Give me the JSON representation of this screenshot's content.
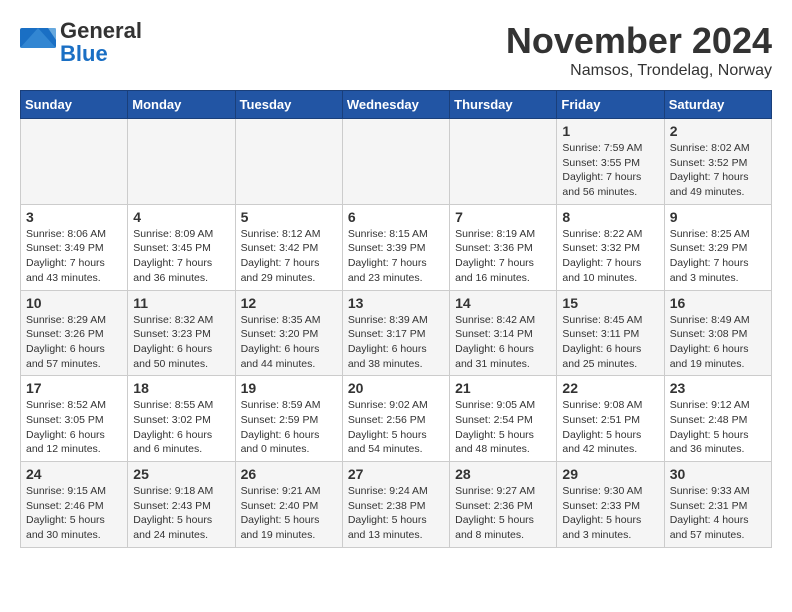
{
  "logo": {
    "general": "General",
    "blue": "Blue"
  },
  "title": "November 2024",
  "location": "Namsos, Trondelag, Norway",
  "days_of_week": [
    "Sunday",
    "Monday",
    "Tuesday",
    "Wednesday",
    "Thursday",
    "Friday",
    "Saturday"
  ],
  "weeks": [
    [
      {
        "day": "",
        "info": ""
      },
      {
        "day": "",
        "info": ""
      },
      {
        "day": "",
        "info": ""
      },
      {
        "day": "",
        "info": ""
      },
      {
        "day": "",
        "info": ""
      },
      {
        "day": "1",
        "info": "Sunrise: 7:59 AM\nSunset: 3:55 PM\nDaylight: 7 hours and 56 minutes."
      },
      {
        "day": "2",
        "info": "Sunrise: 8:02 AM\nSunset: 3:52 PM\nDaylight: 7 hours and 49 minutes."
      }
    ],
    [
      {
        "day": "3",
        "info": "Sunrise: 8:06 AM\nSunset: 3:49 PM\nDaylight: 7 hours and 43 minutes."
      },
      {
        "day": "4",
        "info": "Sunrise: 8:09 AM\nSunset: 3:45 PM\nDaylight: 7 hours and 36 minutes."
      },
      {
        "day": "5",
        "info": "Sunrise: 8:12 AM\nSunset: 3:42 PM\nDaylight: 7 hours and 29 minutes."
      },
      {
        "day": "6",
        "info": "Sunrise: 8:15 AM\nSunset: 3:39 PM\nDaylight: 7 hours and 23 minutes."
      },
      {
        "day": "7",
        "info": "Sunrise: 8:19 AM\nSunset: 3:36 PM\nDaylight: 7 hours and 16 minutes."
      },
      {
        "day": "8",
        "info": "Sunrise: 8:22 AM\nSunset: 3:32 PM\nDaylight: 7 hours and 10 minutes."
      },
      {
        "day": "9",
        "info": "Sunrise: 8:25 AM\nSunset: 3:29 PM\nDaylight: 7 hours and 3 minutes."
      }
    ],
    [
      {
        "day": "10",
        "info": "Sunrise: 8:29 AM\nSunset: 3:26 PM\nDaylight: 6 hours and 57 minutes."
      },
      {
        "day": "11",
        "info": "Sunrise: 8:32 AM\nSunset: 3:23 PM\nDaylight: 6 hours and 50 minutes."
      },
      {
        "day": "12",
        "info": "Sunrise: 8:35 AM\nSunset: 3:20 PM\nDaylight: 6 hours and 44 minutes."
      },
      {
        "day": "13",
        "info": "Sunrise: 8:39 AM\nSunset: 3:17 PM\nDaylight: 6 hours and 38 minutes."
      },
      {
        "day": "14",
        "info": "Sunrise: 8:42 AM\nSunset: 3:14 PM\nDaylight: 6 hours and 31 minutes."
      },
      {
        "day": "15",
        "info": "Sunrise: 8:45 AM\nSunset: 3:11 PM\nDaylight: 6 hours and 25 minutes."
      },
      {
        "day": "16",
        "info": "Sunrise: 8:49 AM\nSunset: 3:08 PM\nDaylight: 6 hours and 19 minutes."
      }
    ],
    [
      {
        "day": "17",
        "info": "Sunrise: 8:52 AM\nSunset: 3:05 PM\nDaylight: 6 hours and 12 minutes."
      },
      {
        "day": "18",
        "info": "Sunrise: 8:55 AM\nSunset: 3:02 PM\nDaylight: 6 hours and 6 minutes."
      },
      {
        "day": "19",
        "info": "Sunrise: 8:59 AM\nSunset: 2:59 PM\nDaylight: 6 hours and 0 minutes."
      },
      {
        "day": "20",
        "info": "Sunrise: 9:02 AM\nSunset: 2:56 PM\nDaylight: 5 hours and 54 minutes."
      },
      {
        "day": "21",
        "info": "Sunrise: 9:05 AM\nSunset: 2:54 PM\nDaylight: 5 hours and 48 minutes."
      },
      {
        "day": "22",
        "info": "Sunrise: 9:08 AM\nSunset: 2:51 PM\nDaylight: 5 hours and 42 minutes."
      },
      {
        "day": "23",
        "info": "Sunrise: 9:12 AM\nSunset: 2:48 PM\nDaylight: 5 hours and 36 minutes."
      }
    ],
    [
      {
        "day": "24",
        "info": "Sunrise: 9:15 AM\nSunset: 2:46 PM\nDaylight: 5 hours and 30 minutes."
      },
      {
        "day": "25",
        "info": "Sunrise: 9:18 AM\nSunset: 2:43 PM\nDaylight: 5 hours and 24 minutes."
      },
      {
        "day": "26",
        "info": "Sunrise: 9:21 AM\nSunset: 2:40 PM\nDaylight: 5 hours and 19 minutes."
      },
      {
        "day": "27",
        "info": "Sunrise: 9:24 AM\nSunset: 2:38 PM\nDaylight: 5 hours and 13 minutes."
      },
      {
        "day": "28",
        "info": "Sunrise: 9:27 AM\nSunset: 2:36 PM\nDaylight: 5 hours and 8 minutes."
      },
      {
        "day": "29",
        "info": "Sunrise: 9:30 AM\nSunset: 2:33 PM\nDaylight: 5 hours and 3 minutes."
      },
      {
        "day": "30",
        "info": "Sunrise: 9:33 AM\nSunset: 2:31 PM\nDaylight: 4 hours and 57 minutes."
      }
    ]
  ]
}
